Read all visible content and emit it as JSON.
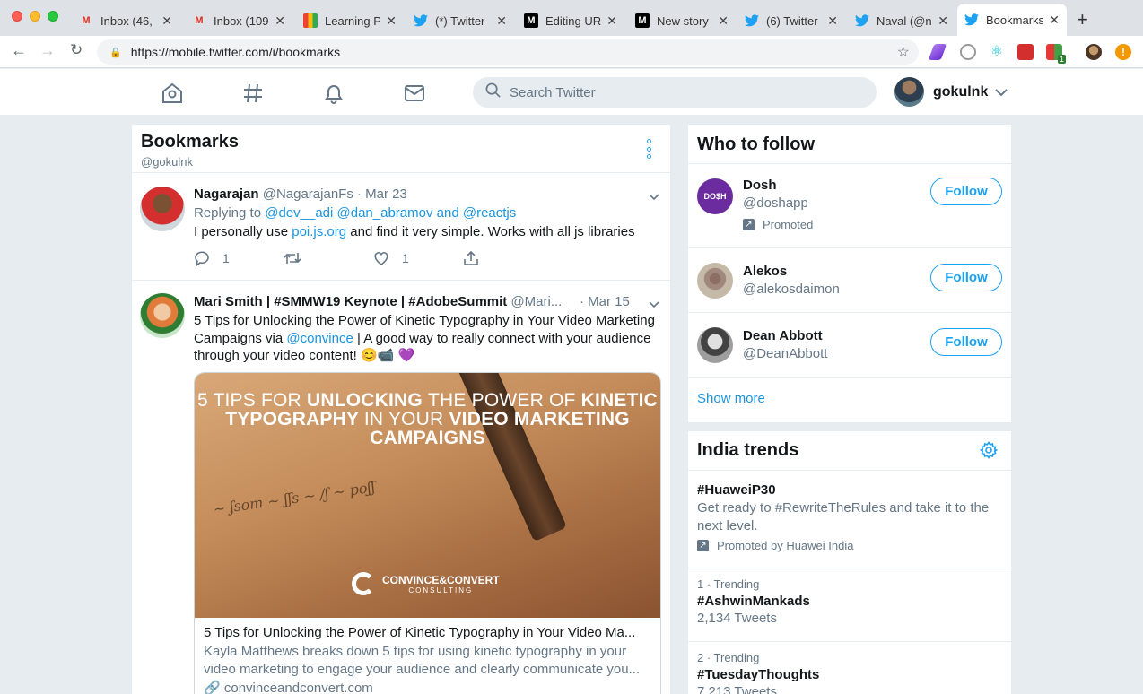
{
  "browser": {
    "tabs": [
      {
        "title": "Inbox (46,",
        "icon": "gmail-icon"
      },
      {
        "title": "Inbox (109",
        "icon": "gmail-icon"
      },
      {
        "title": "Learning P",
        "icon": "learning-icon"
      },
      {
        "title": "(*) Twitter",
        "icon": "twitter-icon"
      },
      {
        "title": "Editing UR",
        "icon": "medium-icon"
      },
      {
        "title": "New story",
        "icon": "medium-icon"
      },
      {
        "title": "(6) Twitter",
        "icon": "twitter-icon"
      },
      {
        "title": "Naval (@n",
        "icon": "twitter-icon"
      },
      {
        "title": "Bookmarks",
        "icon": "twitter-icon",
        "active": true
      }
    ],
    "gmail_badge": "100+",
    "url": "https://mobile.twitter.com/i/bookmarks",
    "ext_badge": "1"
  },
  "header": {
    "search_placeholder": "Search Twitter",
    "username": "gokulnk"
  },
  "bookmarks": {
    "title": "Bookmarks",
    "handle": "@gokulnk",
    "tweets": [
      {
        "name": "Nagarajan",
        "handle": "@NagarajanFs",
        "date": "· Mar 23",
        "reply_prefix": "Replying to",
        "reply_to": "@dev__adi @dan_abramov",
        "reply_and": "and",
        "reply_last": "@reactjs",
        "text_before": "I personally use",
        "text_link": "poi.js.org",
        "text_after": "and find it very simple. Works with all js libraries",
        "reply_count": "1",
        "like_count": "1"
      },
      {
        "name": "Mari Smith | #SMMW19 Keynote | #AdobeSummit",
        "handle": "@Mari...",
        "date": "· Mar 15",
        "text_before": "5 Tips for Unlocking the Power of Kinetic Typography in Your Video Marketing Campaigns via",
        "text_link": "@convince",
        "text_after": "| A good way to really connect with your audience through your video content! 😊📹 💜",
        "card": {
          "headline_l1a": "5 Tips for",
          "headline_l1b": "Unlocking",
          "headline_l1c": "the Power of",
          "headline_l1d": "Kinetic",
          "headline_l2a": "Typography",
          "headline_l2b": "in Your",
          "headline_l2c": "Video Marketing",
          "headline_l3": "Campaigns",
          "logo_text": "CONVINCE&CONVERT",
          "logo_sub": "CONSULTING",
          "title": "5 Tips for Unlocking the Power of Kinetic Typography in Your Video Ma...",
          "description": "Kayla Matthews breaks down 5 tips for using kinetic typography in your video marketing to engage your audience and clearly communicate you...",
          "url": "convinceandconvert.com"
        }
      }
    ]
  },
  "who_to_follow": {
    "title": "Who to follow",
    "follow_label": "Follow",
    "users": [
      {
        "name": "Dosh",
        "handle": "@doshapp",
        "promoted": "Promoted",
        "avatar_text": "DO$H"
      },
      {
        "name": "Alekos",
        "handle": "@alekosdaimon"
      },
      {
        "name": "Dean Abbott",
        "handle": "@DeanAbbott"
      }
    ],
    "show_more": "Show more"
  },
  "trends": {
    "title": "India trends",
    "items": [
      {
        "tag": "#HuaweiP30",
        "desc": "Get ready to #RewriteTheRules and take it to the next level.",
        "promoted": "Promoted by Huawei India"
      },
      {
        "meta": "1 · Trending",
        "tag": "#AshwinMankads",
        "count": "2,134 Tweets"
      },
      {
        "meta": "2 · Trending",
        "tag": "#TuesdayThoughts",
        "count": "7,213 Tweets"
      }
    ]
  },
  "colors": {
    "twitter_blue": "#1da1f2",
    "link": "#1b95e0",
    "background": "#e6ecf0"
  }
}
